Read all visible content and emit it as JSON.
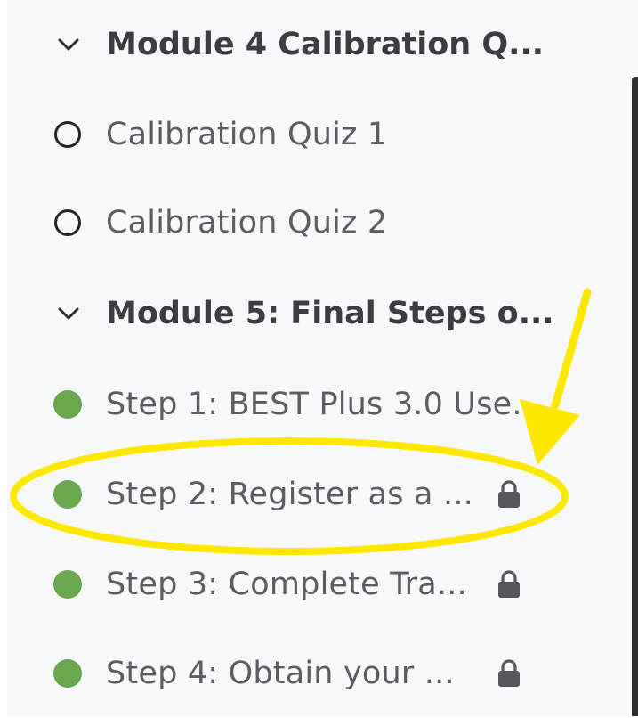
{
  "outline": {
    "modules": [
      {
        "title": "Module 4 Calibration Q...",
        "expanded": true,
        "lessons": [
          {
            "title": "Calibration Quiz 1",
            "status": "not-started",
            "locked": false
          },
          {
            "title": "Calibration Quiz 2",
            "status": "not-started",
            "locked": false
          }
        ]
      },
      {
        "title": "Module 5: Final Steps o...",
        "expanded": true,
        "lessons": [
          {
            "title": "Step 1: BEST Plus 3.0 Use...",
            "status": "complete",
            "locked": false
          },
          {
            "title": "Step 2: Register as a ...",
            "status": "complete",
            "locked": true
          },
          {
            "title": "Step 3: Complete Tra...",
            "status": "complete",
            "locked": true
          },
          {
            "title": "Step 4: Obtain your ...",
            "status": "complete",
            "locked": true
          }
        ]
      }
    ]
  },
  "icons": {
    "module_toggle": "chevron-down-icon",
    "not_started": "empty-circle-icon",
    "complete": "filled-circle-icon",
    "locked": "lock-icon"
  },
  "colors": {
    "panel_background": "#f7f8fa",
    "complete_status": "#6aa84f",
    "annotation": "#ffe800",
    "text": "#5b5d63",
    "module_text": "#3b3d42"
  }
}
